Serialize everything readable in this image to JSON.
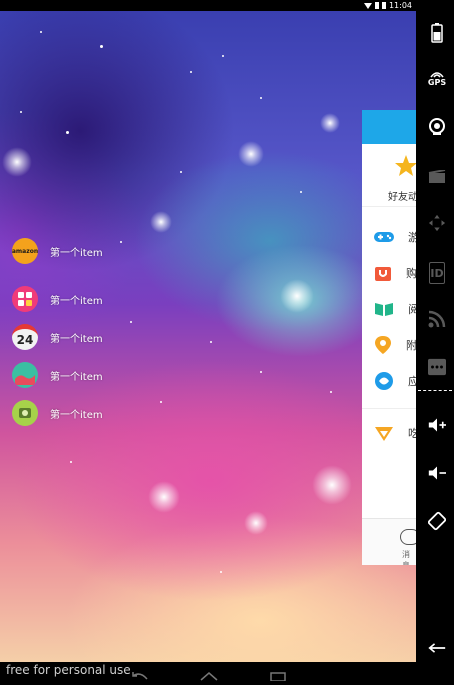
{
  "status_bar": {
    "time": "11:04"
  },
  "menu": {
    "items": [
      {
        "label": "第一个item",
        "icon": "amazon-icon",
        "icon_text": "amazon",
        "color": "#f4a21c"
      },
      {
        "label": "第一个item",
        "icon": "calculator-icon",
        "icon_text": "",
        "color": "#f03b7a"
      },
      {
        "label": "第一个item",
        "icon": "calendar-icon",
        "icon_text": "24",
        "color": "#f2f2f2"
      },
      {
        "label": "第一个item",
        "icon": "chart-app-icon",
        "icon_text": "",
        "color": "#3bbfa2"
      },
      {
        "label": "第一个item",
        "icon": "money-icon",
        "icon_text": "",
        "color": "#a6d24a"
      }
    ]
  },
  "drawer": {
    "friend_label": "好友动",
    "rows": [
      {
        "label": "游",
        "icon": "gamepad-icon",
        "color": "#1e9be8"
      },
      {
        "label": "购",
        "icon": "shopping-bag-icon",
        "color": "#f15a3a"
      },
      {
        "label": "阅",
        "icon": "book-icon",
        "color": "#21b58a"
      },
      {
        "label": "附",
        "icon": "location-icon",
        "color": "#f5a623"
      },
      {
        "label": "应",
        "icon": "app-swirl-icon",
        "color": "#1e9be8"
      }
    ],
    "extra_row": {
      "label": "吃",
      "icon": "food-icon",
      "color": "#f5a623"
    },
    "footer_label": "消息"
  },
  "side_panel": {
    "gps_label": "GPS",
    "id_label": "ID"
  },
  "watermark": "free for personal use"
}
